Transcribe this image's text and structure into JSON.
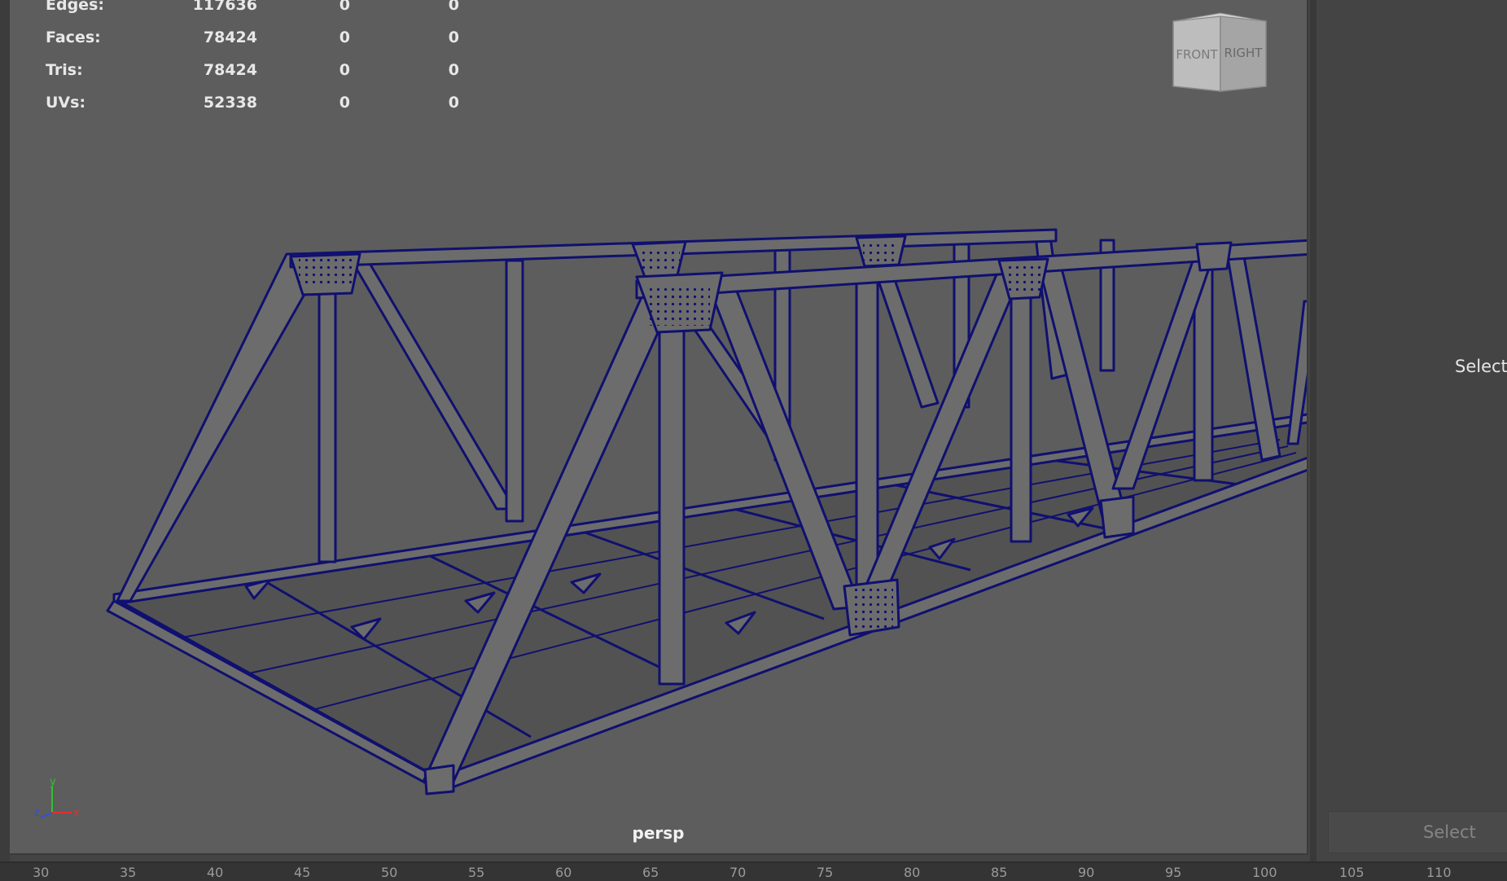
{
  "stats": [
    {
      "label": "Edges:",
      "c1": "117636",
      "c2": "0",
      "c3": "0"
    },
    {
      "label": "Faces:",
      "c1": "78424",
      "c2": "0",
      "c3": "0"
    },
    {
      "label": "Tris:",
      "c1": "78424",
      "c2": "0",
      "c3": "0"
    },
    {
      "label": "UVs:",
      "c1": "52338",
      "c2": "0",
      "c3": "0"
    }
  ],
  "viewcube": {
    "front": "FRONT",
    "right": "RIGHT"
  },
  "axis": {
    "x": "x",
    "y": "y",
    "z": "z"
  },
  "camera_name": "persp",
  "right_panel": {
    "message": "Select a",
    "button": "Select"
  },
  "timeline_ticks": [
    "30",
    "35",
    "40",
    "45",
    "50",
    "55",
    "60",
    "65",
    "70",
    "75",
    "80",
    "85",
    "90",
    "95",
    "100",
    "105",
    "110"
  ],
  "colors": {
    "wireframe": "#101070",
    "viewport_bg": "#5d5d5d",
    "axis_x": "#e03030",
    "axis_y": "#30c030",
    "axis_z": "#3050e0"
  }
}
